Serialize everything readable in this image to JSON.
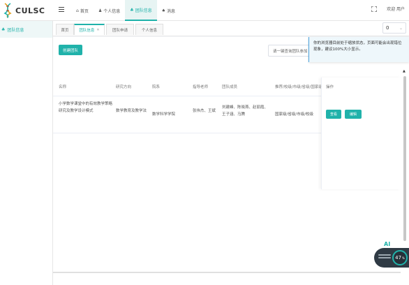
{
  "app": {
    "logo_text": "CULSC"
  },
  "topnav": {
    "items": [
      {
        "label": "首页",
        "icon": "home-icon",
        "active": false
      },
      {
        "label": "个人信息",
        "icon": "user-icon",
        "active": false
      },
      {
        "label": "团队信息",
        "icon": "team-icon",
        "active": true
      },
      {
        "label": "消息",
        "icon": "bell-icon",
        "active": false
      }
    ],
    "user_label": "欢迎 用户"
  },
  "sidebar": {
    "items": [
      {
        "label": "团队信息",
        "icon": "team-icon"
      }
    ]
  },
  "tabs": [
    {
      "label": "首页",
      "active": false,
      "closable": false
    },
    {
      "label": "团队信息",
      "active": true,
      "closable": true
    },
    {
      "label": "团队申请",
      "active": false,
      "closable": false
    },
    {
      "label": "个人信息",
      "active": false,
      "closable": false
    }
  ],
  "tab_counter": {
    "value": "0"
  },
  "toolbar": {
    "create_label": "创建团队",
    "search_placeholder": "请一键查询团队参加"
  },
  "tooltip": {
    "text": "你的浏览器目前处于缩放状态，页面可能会出现错位现象，建议100%大小显示。"
  },
  "table": {
    "headers": [
      "名称",
      "研究方向",
      "院系",
      "指导老师",
      "团队成员",
      "推荐/校级/市级/省级/国家级",
      "操作"
    ],
    "rows": [
      {
        "name": "小学数学课堂中的有效教学策略研究及教学设计模式",
        "direction": "数学教育及教学法",
        "department": "数学科学学院",
        "teacher": "张伟杰、王斌",
        "members": "刘建峰、陈晓燕、赵丽霞、王子涵、马腾",
        "level": "国家级/省级/市级/校级",
        "actions": [
          "查看",
          "编辑"
        ]
      }
    ]
  },
  "ai_widget": {
    "label": "AI",
    "value": "47",
    "unit": "%"
  },
  "colors": {
    "accent": "#20b2aa",
    "tooltip_border": "#4aa3df"
  }
}
